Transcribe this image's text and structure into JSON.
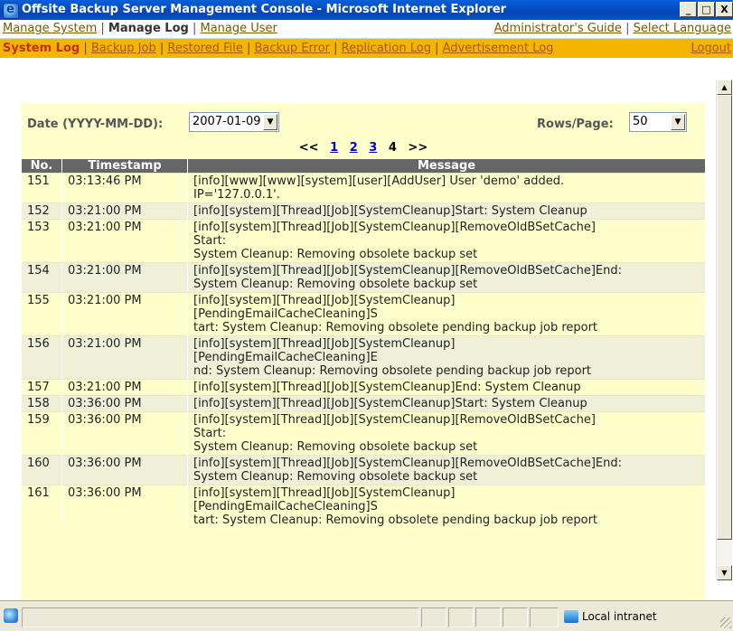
{
  "window": {
    "title": "Offsite Backup Server Management Console - Microsoft Internet Explorer",
    "minimize": "_",
    "maximize": "□",
    "close": "X"
  },
  "nav_main": {
    "manage_system": "Manage System",
    "manage_log": "Manage Log",
    "manage_user": "Manage User",
    "admin_guide": "Administrator's Guide",
    "select_language": "Select Language",
    "separator": "|"
  },
  "nav_sub": {
    "system_log": "System Log",
    "backup_job": "Backup Job",
    "restored_file": "Restored File",
    "backup_error": "Backup Error",
    "replication_log": "Replication Log",
    "advertisement_log": "Advertisement Log",
    "logout": "Logout"
  },
  "filters": {
    "date_label": "Date (YYYY-MM-DD):",
    "date_value": "2007-01-09",
    "rows_label": "Rows/Page:",
    "rows_value": "50"
  },
  "pager": {
    "prev": "<<",
    "pages": [
      "1",
      "2",
      "3",
      "4"
    ],
    "current": "4",
    "next": ">>"
  },
  "table": {
    "headers": [
      "No.",
      "Timestamp",
      "Message"
    ],
    "rows": [
      {
        "no": "151",
        "ts": "03:13:46 PM",
        "msg": "[info][www][www][system][user][AddUser] User 'demo' added.\nIP='127.0.0.1'."
      },
      {
        "no": "152",
        "ts": "03:21:00 PM",
        "msg": "[info][system][Thread][Job][SystemCleanup]Start: System Cleanup"
      },
      {
        "no": "153",
        "ts": "03:21:00 PM",
        "msg": "[info][system][Thread][Job][SystemCleanup][RemoveOldBSetCache]\nStart:\nSystem Cleanup: Removing obsolete backup set"
      },
      {
        "no": "154",
        "ts": "03:21:00 PM",
        "msg": "[info][system][Thread][Job][SystemCleanup][RemoveOldBSetCache]End:\nSystem Cleanup: Removing obsolete backup set"
      },
      {
        "no": "155",
        "ts": "03:21:00 PM",
        "msg": "[info][system][Thread][Job][SystemCleanup]\n[PendingEmailCacheCleaning]S\ntart: System Cleanup: Removing obsolete pending backup job report"
      },
      {
        "no": "156",
        "ts": "03:21:00 PM",
        "msg": "[info][system][Thread][Job][SystemCleanup]\n[PendingEmailCacheCleaning]E\nnd: System Cleanup: Removing obsolete pending backup job report"
      },
      {
        "no": "157",
        "ts": "03:21:00 PM",
        "msg": "[info][system][Thread][Job][SystemCleanup]End: System Cleanup"
      },
      {
        "no": "158",
        "ts": "03:36:00 PM",
        "msg": "[info][system][Thread][Job][SystemCleanup]Start: System Cleanup"
      },
      {
        "no": "159",
        "ts": "03:36:00 PM",
        "msg": "[info][system][Thread][Job][SystemCleanup][RemoveOldBSetCache]\nStart:\nSystem Cleanup: Removing obsolete backup set"
      },
      {
        "no": "160",
        "ts": "03:36:00 PM",
        "msg": "[info][system][Thread][Job][SystemCleanup][RemoveOldBSetCache]End:\nSystem Cleanup: Removing obsolete backup set"
      },
      {
        "no": "161",
        "ts": "03:36:00 PM",
        "msg": "[info][system][Thread][Job][SystemCleanup]\n[PendingEmailCacheCleaning]S\ntart: System Cleanup: Removing obsolete pending backup job report"
      }
    ]
  },
  "statusbar": {
    "zone": "Local intranet"
  }
}
